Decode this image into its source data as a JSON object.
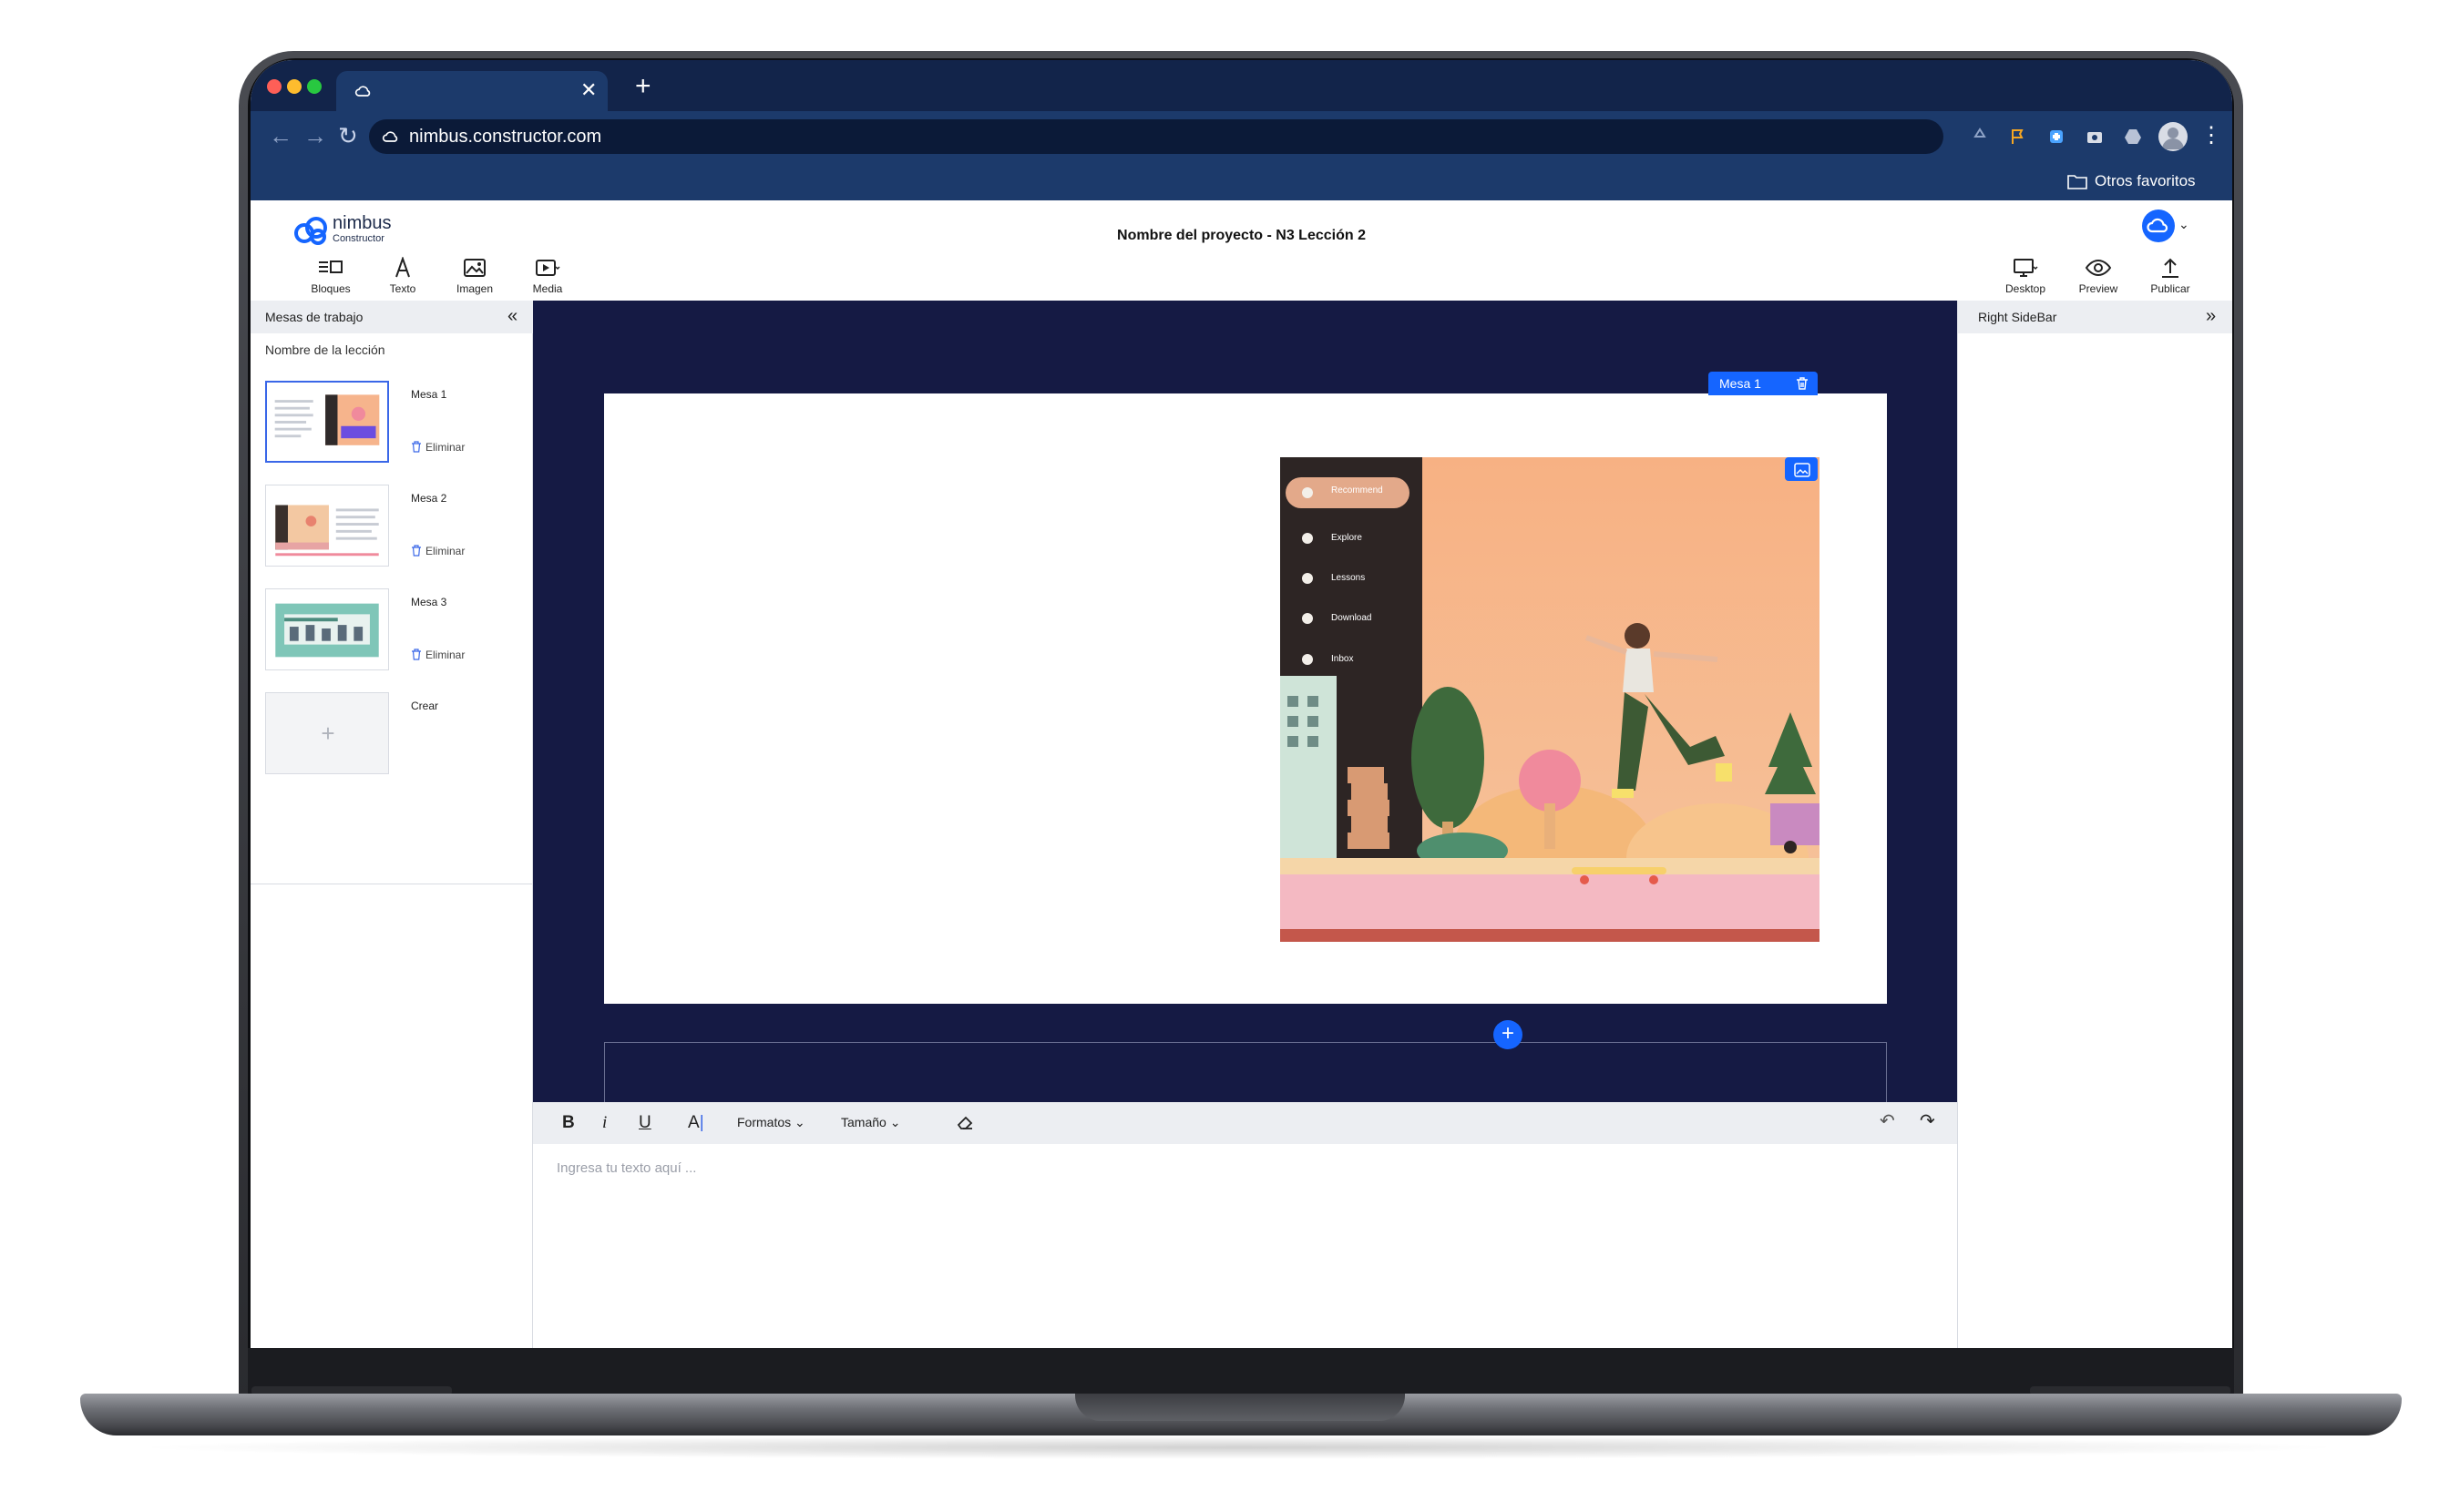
{
  "browser": {
    "url": "nimbus.constructor.com",
    "bookmark_folder": "Otros favoritos",
    "tab_close": "✕",
    "new_tab": "+"
  },
  "app": {
    "logo_name": "nimbus",
    "logo_sub": "Constructor",
    "project_title": "Nombre del proyecto - N3 Lección 2",
    "tools_left": {
      "bloques": "Bloques",
      "texto": "Texto",
      "imagen": "Imagen",
      "media": "Media"
    },
    "tools_right": {
      "desktop": "Desktop",
      "preview": "Preview",
      "publicar": "Publicar"
    },
    "accent_color": "#1565ff",
    "canvas_color": "#151a44"
  },
  "left_sidebar": {
    "title": "Mesas de trabajo",
    "lesson_name": "Nombre de la lección",
    "slides": [
      {
        "label": "Mesa 1",
        "delete": "Eliminar",
        "active": true
      },
      {
        "label": "Mesa 2",
        "delete": "Eliminar",
        "active": false
      },
      {
        "label": "Mesa 3",
        "delete": "Eliminar",
        "active": false
      }
    ],
    "create_label": "Crear"
  },
  "canvas": {
    "mesa_tag": "Mesa 1",
    "image_menu": [
      "Recommend",
      "Explore",
      "Lessons",
      "Download",
      "Inbox"
    ]
  },
  "editor": {
    "bold": "B",
    "italic": "i",
    "underline": "U",
    "color": "A",
    "formatos": "Formatos",
    "tamano": "Tamaño",
    "placeholder": "Ingresa tu texto aquí ..."
  },
  "right_sidebar": {
    "title": "Right SideBar"
  }
}
